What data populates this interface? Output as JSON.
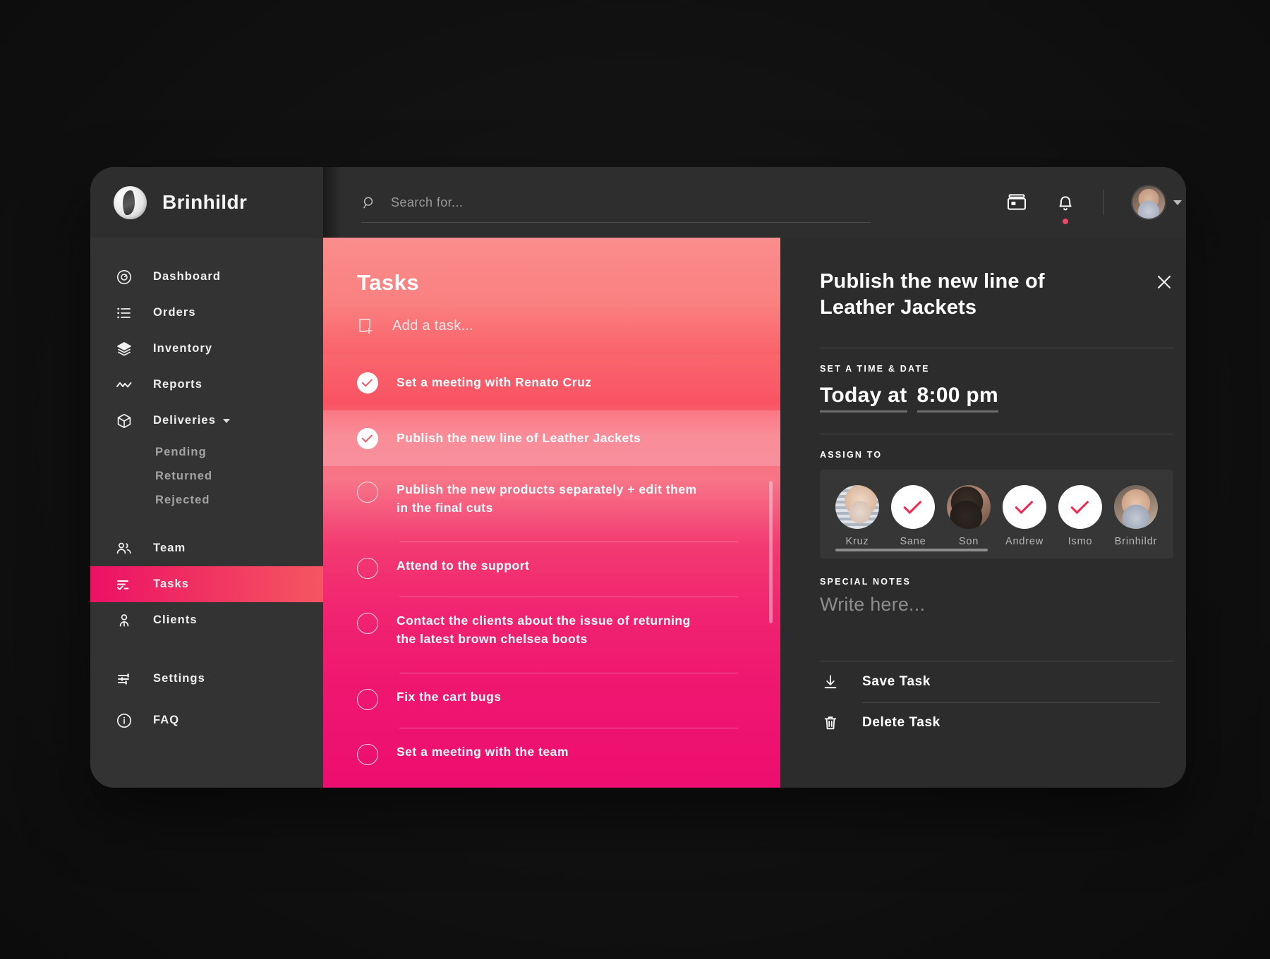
{
  "brand": {
    "name": "Brinhildr",
    "logo_icon": "circle-leaf-logo"
  },
  "sidebar": {
    "items": [
      {
        "label": "Dashboard",
        "icon": "speedometer-icon",
        "active": false
      },
      {
        "label": "Orders",
        "icon": "list-icon",
        "active": false
      },
      {
        "label": "Inventory",
        "icon": "layers-icon",
        "active": false
      },
      {
        "label": "Reports",
        "icon": "chart-line-icon",
        "active": false
      },
      {
        "label": "Deliveries",
        "icon": "box-icon",
        "active": false,
        "expandable": true
      }
    ],
    "deliveries_sub": [
      "Pending",
      "Returned",
      "Rejected"
    ],
    "items2": [
      {
        "label": "Team",
        "icon": "people-icon",
        "active": false
      },
      {
        "label": "Tasks",
        "icon": "checklist-icon",
        "active": true
      },
      {
        "label": "Clients",
        "icon": "person-icon",
        "active": false
      }
    ],
    "bottom": [
      {
        "label": "Settings",
        "icon": "sliders-icon"
      },
      {
        "label": "FAQ",
        "icon": "info-circle-icon"
      }
    ]
  },
  "topbar": {
    "search_placeholder": "Search for...",
    "search_value": "",
    "search_icon": "search-icon",
    "archive_icon": "inbox-icon",
    "bell_icon": "bell-icon",
    "has_notification": true,
    "avatar_icon": "user-avatar",
    "caret_icon": "chevron-down-icon"
  },
  "tasks": {
    "title": "Tasks",
    "add_placeholder": "Add a task...",
    "add_icon": "add-note-icon",
    "list": [
      {
        "label": "Set a meeting with Renato Cruz",
        "done": true,
        "highlight": "a"
      },
      {
        "label": "Publish the new line of Leather Jackets",
        "done": true,
        "highlight": "b"
      },
      {
        "label": "Publish the new products separately + edit them in the final cuts",
        "done": false,
        "highlight": ""
      },
      {
        "label": "Attend to the support",
        "done": false,
        "highlight": ""
      },
      {
        "label": "Contact the clients about the issue of returning the latest brown chelsea boots",
        "done": false,
        "highlight": ""
      },
      {
        "label": "Fix the cart bugs",
        "done": false,
        "highlight": ""
      },
      {
        "label": "Set a meeting with the team",
        "done": false,
        "highlight": ""
      }
    ]
  },
  "detail": {
    "title": "Publish the new line of Leather Jackets",
    "close_icon": "close-icon",
    "time_label": "SET A TIME & DATE",
    "date_value": "Today at",
    "time_value": "8:00 pm",
    "assign_label": "ASSIGN TO",
    "assignees": [
      {
        "name": "Kruz",
        "selected": false,
        "photo": "p1"
      },
      {
        "name": "Sane",
        "selected": true,
        "photo": ""
      },
      {
        "name": "Son",
        "selected": false,
        "photo": "p2"
      },
      {
        "name": "Andrew",
        "selected": true,
        "photo": ""
      },
      {
        "name": "Ismo",
        "selected": true,
        "photo": ""
      },
      {
        "name": "Brinhildr",
        "selected": false,
        "photo": "p3"
      }
    ],
    "notes_label": "SPECIAL NOTES",
    "notes_placeholder": "Write here...",
    "notes_value": "",
    "actions": [
      {
        "label": "Save Task",
        "icon": "download-icon"
      },
      {
        "label": "Delete Task",
        "icon": "trash-icon"
      }
    ]
  },
  "colors": {
    "accent_pink": "#ec1164",
    "accent_coral": "#f55661",
    "panel_dark": "#2c2c2c",
    "sidebar_dark": "#333333",
    "notification_dot": "#f0466c"
  }
}
